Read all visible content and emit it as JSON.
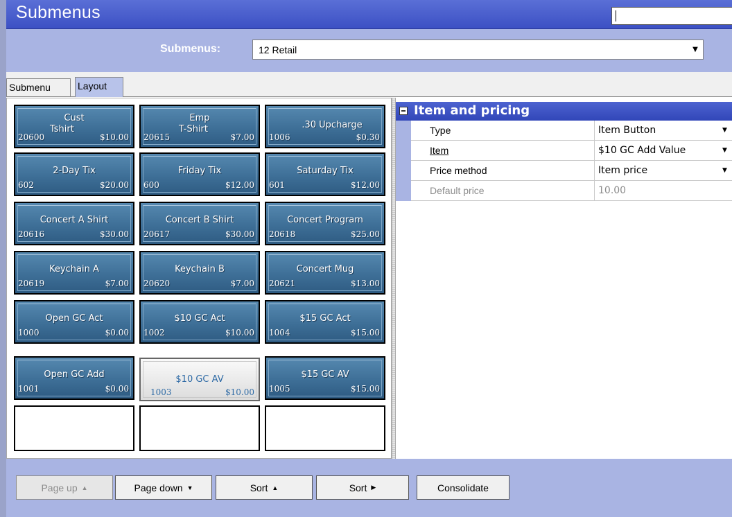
{
  "window": {
    "title": "Submenus",
    "search_value": ""
  },
  "selector": {
    "label": "Submenus:",
    "value": "12 Retail"
  },
  "tabs": [
    {
      "label": "Submenu"
    },
    {
      "label": "Layout"
    }
  ],
  "grid": {
    "rows": [
      [
        {
          "name": "Cust",
          "name2": "Tshirt",
          "num": "20600",
          "price": "$10.00"
        },
        {
          "name": "Emp",
          "name2": "T-Shirt",
          "num": "20615",
          "price": "$7.00"
        },
        {
          "name": ".30 Upcharge",
          "num": "1006",
          "price": "$0.30"
        }
      ],
      [
        {
          "name": "2-Day Tix",
          "num": "602",
          "price": "$20.00"
        },
        {
          "name": "Friday Tix",
          "num": "600",
          "price": "$12.00"
        },
        {
          "name": "Saturday Tix",
          "num": "601",
          "price": "$12.00"
        }
      ],
      [
        {
          "name": "Concert A Shirt",
          "num": "20616",
          "price": "$30.00"
        },
        {
          "name": "Concert B Shirt",
          "num": "20617",
          "price": "$30.00"
        },
        {
          "name": "Concert Program",
          "num": "20618",
          "price": "$25.00"
        }
      ],
      [
        {
          "name": "Keychain A",
          "num": "20619",
          "price": "$7.00"
        },
        {
          "name": "Keychain B",
          "num": "20620",
          "price": "$7.00"
        },
        {
          "name": "Concert Mug",
          "num": "20621",
          "price": "$13.00"
        }
      ],
      [
        {
          "name": "Open GC Act",
          "num": "1000",
          "price": "$0.00"
        },
        {
          "name": "$10 GC Act",
          "num": "1002",
          "price": "$10.00"
        },
        {
          "name": "$15 GC Act",
          "num": "1004",
          "price": "$15.00"
        }
      ],
      [
        {
          "name": "Open GC Add",
          "num": "1001",
          "price": "$0.00"
        },
        {
          "name": "$10 GC AV",
          "num": "1003",
          "price": "$10.00",
          "selected": true
        },
        {
          "name": "$15 GC AV",
          "num": "1005",
          "price": "$15.00"
        }
      ]
    ]
  },
  "properties": {
    "section": "Item and pricing",
    "rows": [
      {
        "name": "Type",
        "value": "Item Button"
      },
      {
        "name": "Item",
        "value": "$10 GC Add Value"
      },
      {
        "name": "Price method",
        "value": "Item price"
      },
      {
        "name": "Default price",
        "value": "10.00"
      }
    ]
  },
  "toolbar": {
    "page_up": "Page up",
    "page_down": "Page down",
    "sort_up": "Sort",
    "sort_right": "Sort",
    "consolidate": "Consolidate"
  },
  "colors": {
    "title_bar": "#3c50c4",
    "band": "#a9b4e3",
    "button": "#3e6f97",
    "accent_text": "#2e6aa5"
  }
}
